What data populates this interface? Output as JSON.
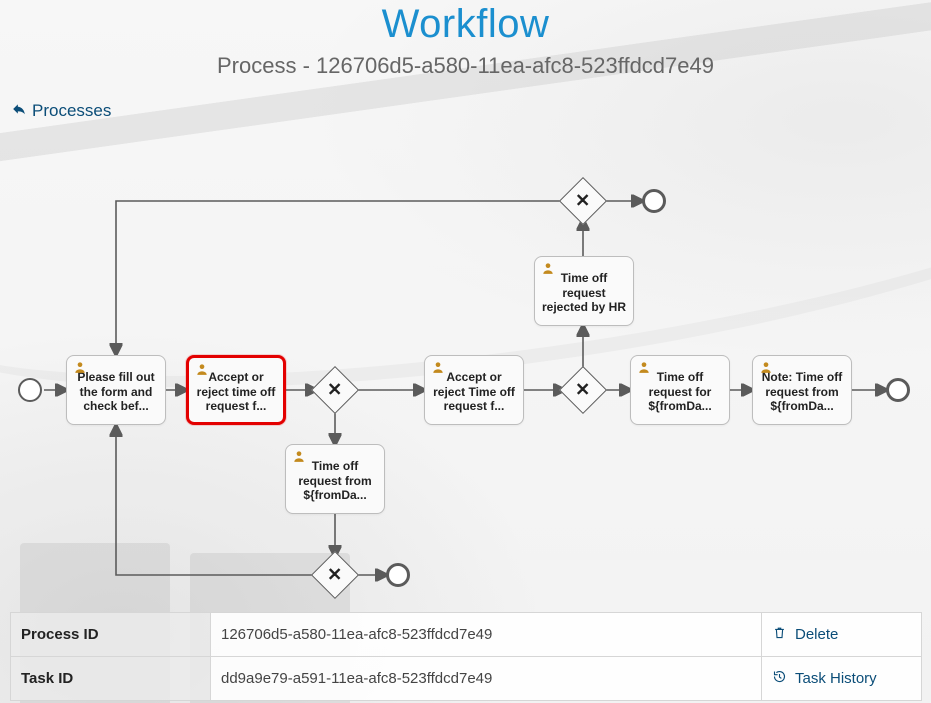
{
  "title": "Workflow",
  "subtitle": "Process - 126706d5-a580-11ea-afc8-523ffdcd7e49",
  "back_link": "Processes",
  "tasks": {
    "fill_form": "Please fill out the form and check bef...",
    "accept_reject_1": "Accept or reject time off request f...",
    "accept_reject_2": "Accept or reject Time off request f...",
    "request_for": "Time off request for ${fromDa...",
    "note": "Note: Time off request from ${fromDa...",
    "rejected_hr": "Time off request rejected by HR",
    "request_from": "Time off request from ${fromDa..."
  },
  "info": {
    "process_id_label": "Process ID",
    "process_id_value": "126706d5-a580-11ea-afc8-523ffdcd7e49",
    "task_id_label": "Task ID",
    "task_id_value": "dd9a9e79-a591-11ea-afc8-523ffdcd7e49"
  },
  "actions": {
    "delete": "Delete",
    "task_history": "Task History"
  }
}
